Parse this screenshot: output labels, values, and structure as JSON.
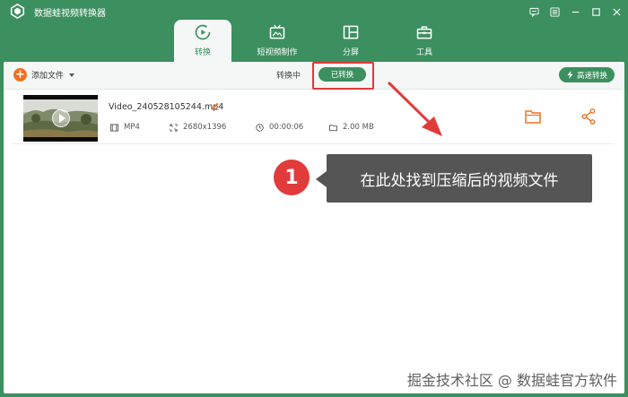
{
  "window": {
    "title": "数据蛙视频转换器",
    "controls": [
      "feedback-icon",
      "menu-icon",
      "minimize-icon",
      "maximize-icon",
      "close-icon"
    ]
  },
  "nav": {
    "tabs": [
      {
        "label": "转换",
        "icon": "convert-icon",
        "active": true
      },
      {
        "label": "短视频制作",
        "icon": "tv-icon",
        "active": false
      },
      {
        "label": "分屏",
        "icon": "split-screen-icon",
        "active": false
      },
      {
        "label": "工具",
        "icon": "toolbox-icon",
        "active": false
      }
    ]
  },
  "toolbar": {
    "add_file_label": "添加文件",
    "converting_label": "转换中",
    "converted_label": "已转换",
    "fast_convert_label": "高速转换"
  },
  "file": {
    "name": "Video_240528105244.mp4",
    "format": "MP4",
    "resolution": "2680x1396",
    "duration": "00:00:06",
    "size": "2.00 MB"
  },
  "annotation": {
    "number": "1",
    "text": "在此处找到压缩后的视频文件"
  },
  "watermark": "掘金技术社区 @ 数据蛙官方软件",
  "colors": {
    "brand_green": "#3c8f5f",
    "accent_orange": "#f07022",
    "highlight_red": "#e03a3a",
    "callout_gray": "#555556"
  }
}
